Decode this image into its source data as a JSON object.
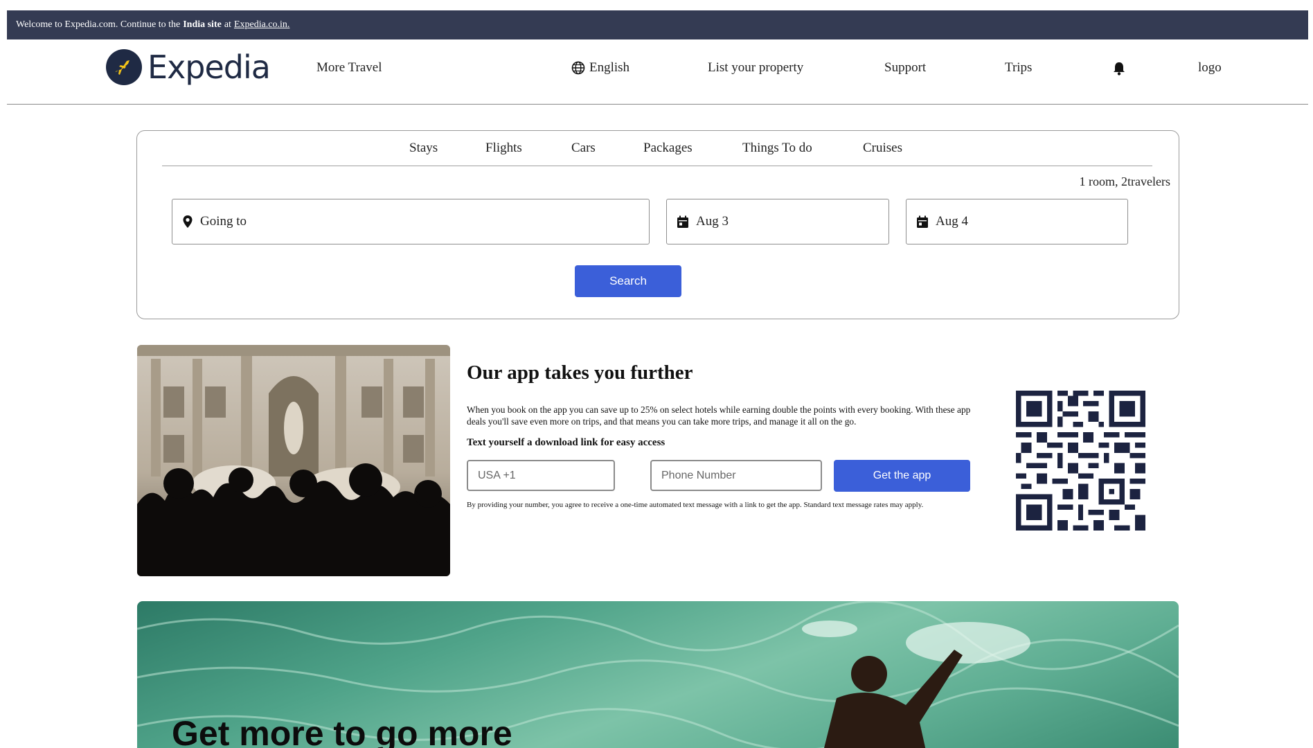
{
  "banner": {
    "prefix": "Welcome to Expedia.com. Continue to the",
    "bold": "India site",
    "mid": "at",
    "link": "Expedia.co.in."
  },
  "header": {
    "brand": "Expedia",
    "more_travel": "More Travel",
    "language": "English",
    "list_property": "List your property",
    "support": "Support",
    "trips": "Trips",
    "logo_text": "logo"
  },
  "search": {
    "tabs": [
      "Stays",
      "Flights",
      "Cars",
      "Packages",
      "Things To do",
      "Cruises"
    ],
    "travelers": "1 room, 2travelers",
    "destination_placeholder": "Going to",
    "checkin": "Aug 3",
    "checkout": "Aug 4",
    "button": "Search"
  },
  "promo": {
    "title": "Our app takes you further",
    "text": "When you book on the app you can save up to 25% on select hotels while earning double the points with every booking. With these app deals you'll save even more on trips, and that means you can take more trips, and manage it all on the go.",
    "subtitle": "Text yourself a download link for easy access",
    "country_code_placeholder": "USA +1",
    "phone_placeholder": "Phone Number",
    "button": "Get the app",
    "disclaimer": "By providing your number, you agree to receive a one-time automated text message with a link to get the app. Standard text message rates may apply."
  },
  "hero": {
    "title": "Get more to go more"
  },
  "colors": {
    "banner_bg": "#343b53",
    "brand_navy": "#1f2a44",
    "button_blue": "#3b5fd9"
  },
  "icons": [
    "globe-icon",
    "bell-icon",
    "location-pin-icon",
    "calendar-icon",
    "plane-icon",
    "qr-code-icon"
  ]
}
